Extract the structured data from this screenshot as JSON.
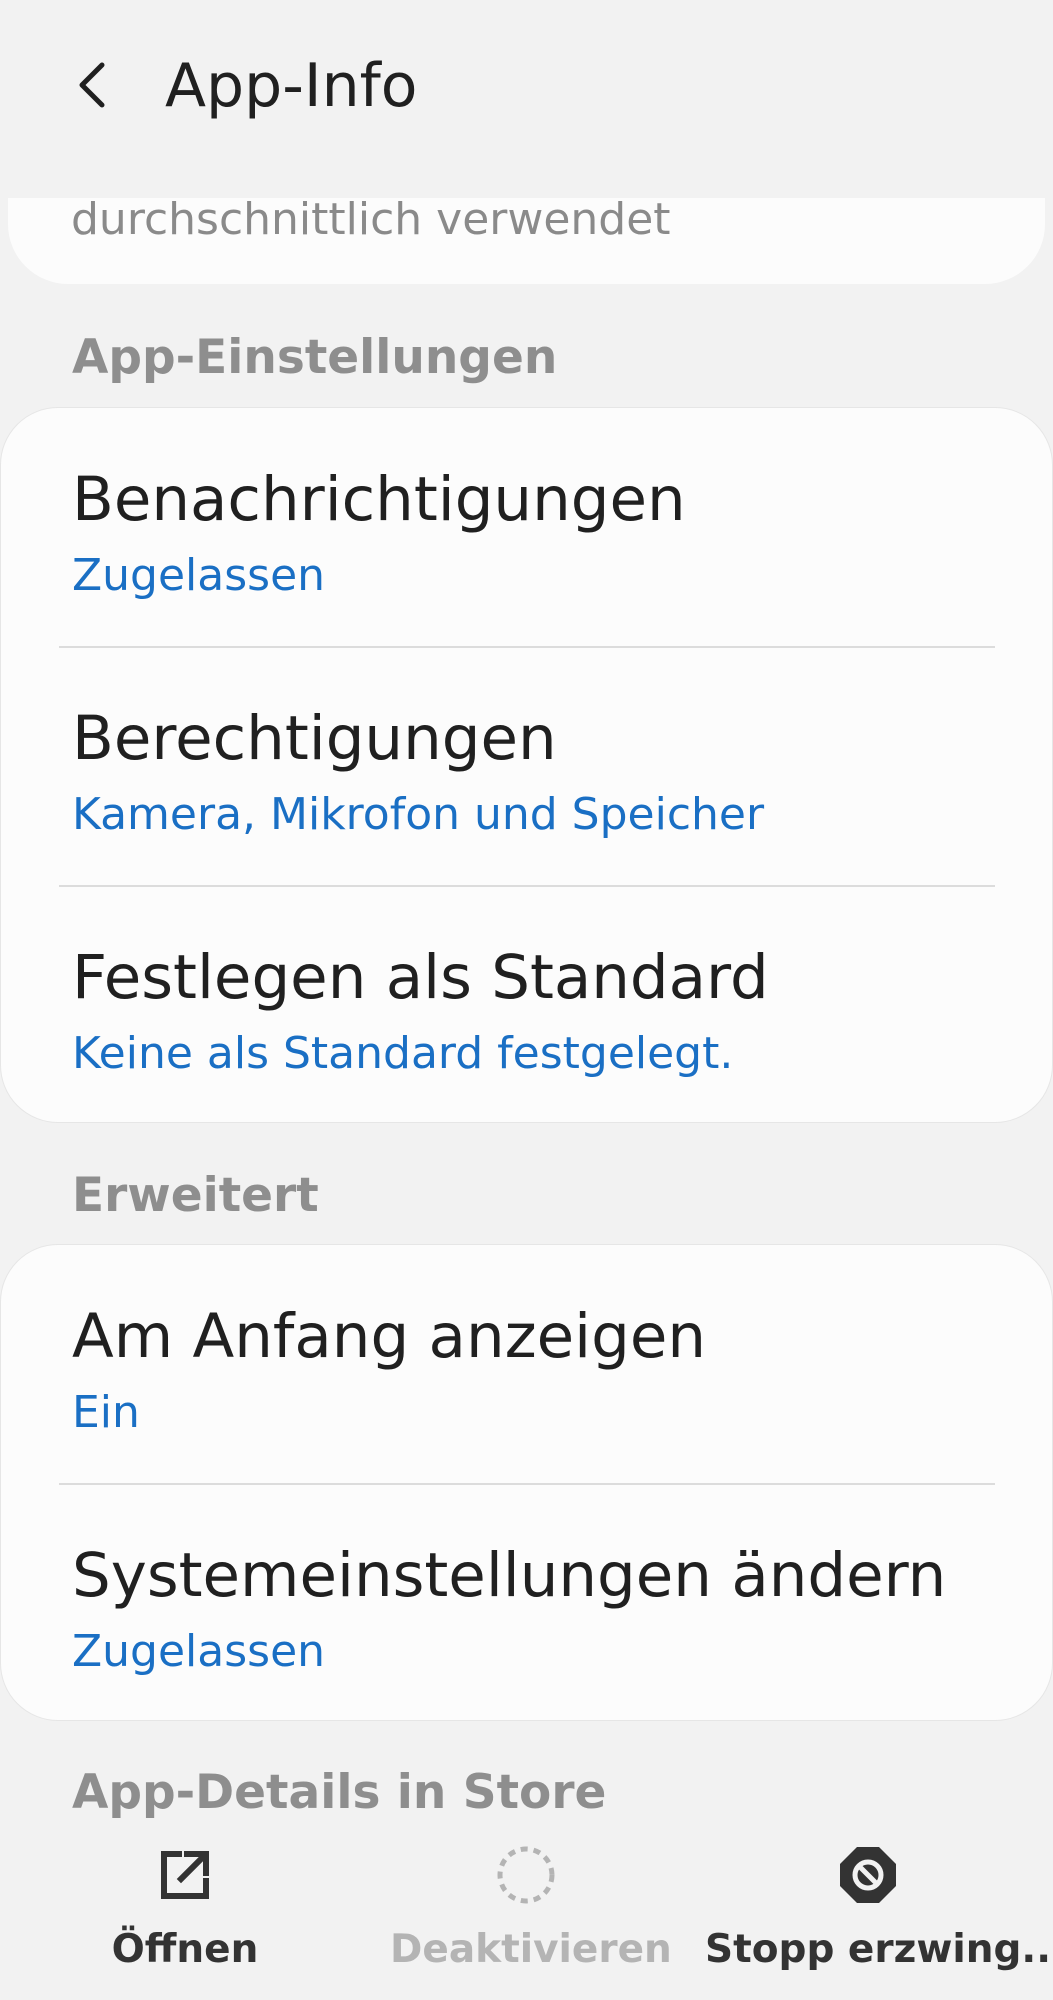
{
  "header": {
    "title": "App-Info",
    "back_icon": "chevron-left-icon"
  },
  "usage_summary": {
    "text": "durchschnittlich verwendet"
  },
  "app_settings": {
    "section_title": "App-Einstellungen",
    "items": [
      {
        "title": "Benachrichtigungen",
        "subtitle": "Zugelassen"
      },
      {
        "title": "Berechtigungen",
        "subtitle": "Kamera, Mikrofon und Speicher"
      },
      {
        "title": "Festlegen als Standard",
        "subtitle": "Keine als Standard festgelegt."
      }
    ]
  },
  "advanced": {
    "section_title": "Erweitert",
    "items": [
      {
        "title": "Am Anfang anzeigen",
        "subtitle": "Ein"
      },
      {
        "title": "Systemeinstellungen ändern",
        "subtitle": "Zugelassen"
      }
    ]
  },
  "store": {
    "section_title": "App-Details in Store"
  },
  "bottom_actions": [
    {
      "label": "Öffnen",
      "icon": "open-external-icon",
      "enabled": true
    },
    {
      "label": "Deaktivieren",
      "icon": "disable-dashed-circle-icon",
      "enabled": false
    },
    {
      "label": "Stopp erzwing...",
      "icon": "force-stop-icon",
      "enabled": true
    }
  ],
  "colors": {
    "background": "#f2f2f2",
    "card": "#fcfcfc",
    "accent_blue": "#1a6fc4",
    "section_gray": "#8e8e8e",
    "disabled_gray": "#b4b4b4",
    "text_dark": "#202020"
  }
}
